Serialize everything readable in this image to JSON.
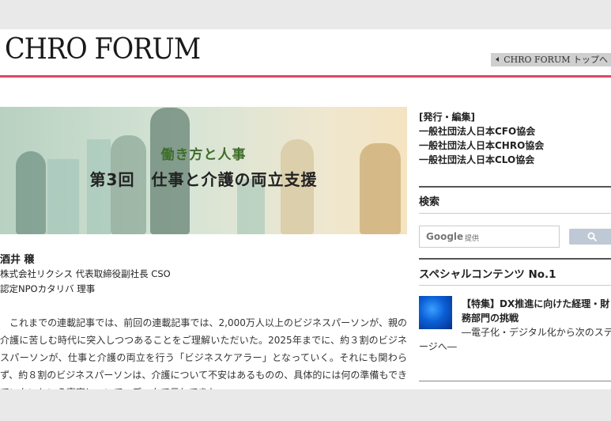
{
  "header": {
    "logo": "CHRO FORUM",
    "top_link": "CHRO FORUM トップへ"
  },
  "banner": {
    "subtitle": "働き方と人事",
    "title": "第3回　仕事と介護の両立支援"
  },
  "author": {
    "name": "酒井 穣",
    "line1": "株式会社リクシス 代表取締役副社長 CSO",
    "line2": "認定NPOカタリバ 理事"
  },
  "article": {
    "body": "これまでの連載記事では、前回の連載記事では、2,000万人以上のビジネスパーソンが、親の介護に苦しむ時代に突入しつつあることをご理解いただいた。2025年までに、約３割のビジネスパーソンが、仕事と介護の両立を行う「ビジネスケアラー」となっていく。それにも関わらず、約８割のビジネスパーソンは、介護について不安はあるものの、具体的には何の準備もできていないという事実について、データで示してきた。"
  },
  "sidebar": {
    "publisher_label": "[発行・編集]",
    "publishers": [
      "一般社団法人日本CFO協会",
      "一般社団法人日本CHRO協会",
      "一般社団法人日本CLO協会"
    ],
    "search_heading": "検索",
    "search_brand": "Google",
    "search_placeholder": "提供",
    "special_heading": "スペシャルコンテンツ No.1",
    "special_title": "【特集】DX推進に向けた経理・財務部門の挑戦",
    "special_sub1": "―電子化・デジタル化から次のステ",
    "special_sub2": "ージへ―"
  },
  "colors": {
    "accent_rule": "#d94a66",
    "banner_subtitle": "#3f6d2a",
    "search_button": "#bfc9d6"
  }
}
